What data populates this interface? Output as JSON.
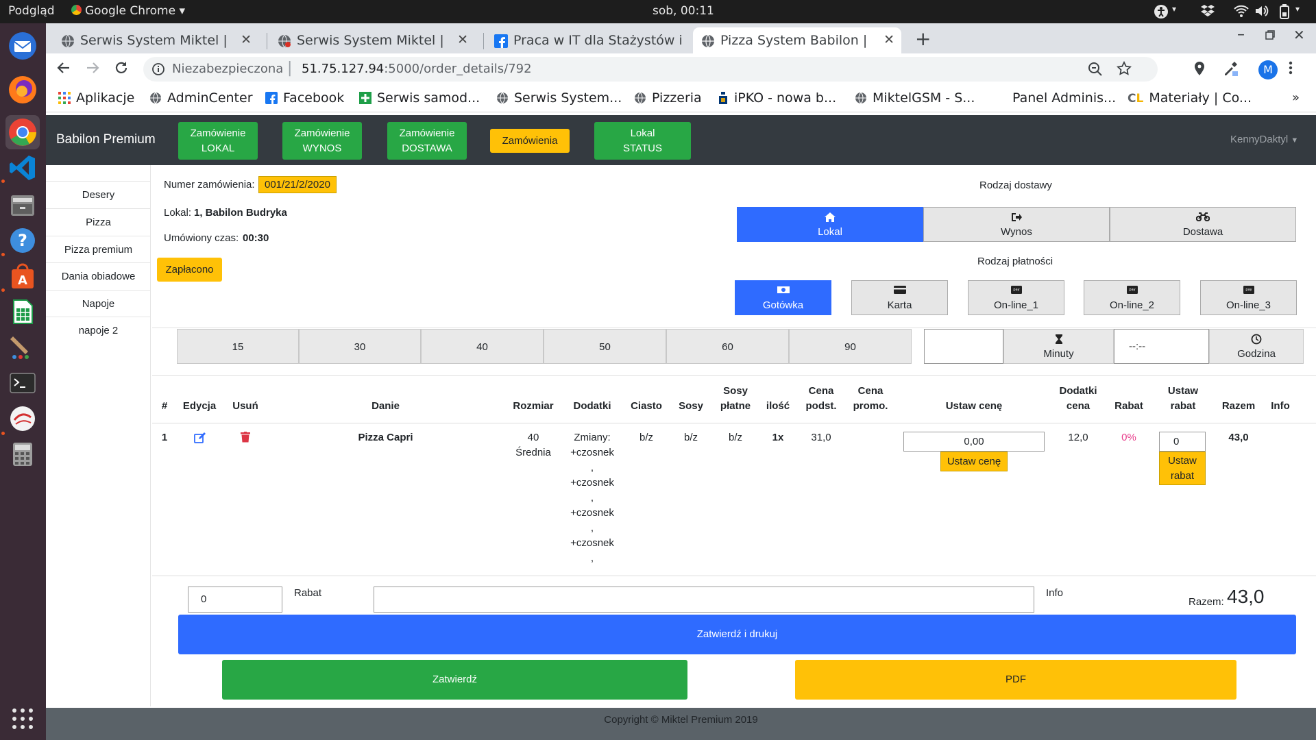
{
  "os": {
    "activities": "Podgląd",
    "app_name": "Google Chrome",
    "clock": "sob, 00:11"
  },
  "browser": {
    "tabs": [
      {
        "title": "Serwis System Miktel |"
      },
      {
        "title": "Serwis System Miktel |"
      },
      {
        "title": "Praca w IT dla Stażystów i"
      },
      {
        "title": "Pizza System Babilon |"
      }
    ],
    "security_label": "Niezabezpieczona",
    "url_host": "51.75.127.94",
    "url_path": ":5000/order_details/792",
    "profile_initial": "M",
    "bookmarks": [
      "Aplikacje",
      "AdminCenter",
      "Facebook",
      "Serwis samod...",
      "Serwis System...",
      "Pizzeria",
      "iPKO - nowa b...",
      "MiktelGSM - S...",
      "Panel Adminis...",
      "Materiały | Co..."
    ],
    "bookmarks_more": "»"
  },
  "navbar": {
    "brand": "Babilon Premium",
    "btn_lokal": [
      "Zamówienie",
      "LOKAL"
    ],
    "btn_wynos": [
      "Zamówienie",
      "WYNOS"
    ],
    "btn_dostawa": [
      "Zamówienie",
      "DOSTAWA"
    ],
    "btn_zamowienia": "Zamówienia",
    "btn_status": [
      "Lokal",
      "STATUS"
    ],
    "user": "KennyDaktyl"
  },
  "sidebar": {
    "items": [
      "Desery",
      "Pizza",
      "Pizza premium",
      "Dania obiadowe",
      "Napoje",
      "napoje 2"
    ]
  },
  "order": {
    "number_label": "Numer zamówienia:",
    "number": "001/21/2/2020",
    "local_label": "Lokal:",
    "local_value": "1, Babilon Budryka",
    "time_label": "Umówiony czas:",
    "time_value": "00:30",
    "paid_label": "Zapłacono"
  },
  "delivery": {
    "title": "Rodzaj dostawy",
    "options": [
      "Lokal",
      "Wynos",
      "Dostawa"
    ],
    "selected": "Lokal"
  },
  "payment": {
    "title": "Rodzaj płatności",
    "options": [
      "Gotówka",
      "Karta",
      "On-line_1",
      "On-line_2",
      "On-line_3"
    ],
    "selected": "Gotówka"
  },
  "time_presets": [
    "15",
    "30",
    "40",
    "50",
    "60",
    "90"
  ],
  "minutes_label": "Minuty",
  "time_placeholder": "--:--",
  "hour_label": "Godzina",
  "table": {
    "headers": {
      "num": "#",
      "edit": "Edycja",
      "delete": "Usuń",
      "dish": "Danie",
      "size": "Rozmiar",
      "addons": "Dodatki",
      "dough": "Ciasto",
      "sauces": "Sosy",
      "paid_sauces": [
        "Sosy",
        "płatne"
      ],
      "qty": "ilość",
      "base_price": [
        "Cena",
        "podst."
      ],
      "promo_price": [
        "Cena",
        "promo."
      ],
      "set_price": "Ustaw cenę",
      "addons_price": [
        "Dodatki",
        "cena"
      ],
      "discount": "Rabat",
      "set_discount": [
        "Ustaw",
        "rabat"
      ],
      "total": "Razem",
      "info": "Info"
    },
    "rows": [
      {
        "num": "1",
        "dish": "Pizza Capri",
        "size": [
          "40",
          "Średnia"
        ],
        "addons": [
          "Zmiany:",
          "+czosnek",
          ",",
          "+czosnek",
          ",",
          "+czosnek",
          ",",
          "+czosnek",
          ","
        ],
        "dough": "b/z",
        "sauces": "b/z",
        "paid_sauces": "b/z",
        "qty": "1x",
        "base_price": "31,0",
        "promo_price": "",
        "set_price_value": "0,00",
        "set_price_button": "Ustaw cenę",
        "addons_price": "12,0",
        "discount": "0%",
        "set_discount_value": "0",
        "set_discount_button": [
          "Ustaw",
          "rabat"
        ],
        "total": "43,0",
        "info": ""
      }
    ]
  },
  "footer_form": {
    "discount_value": "0",
    "discount_label": "Rabat",
    "info_value": "",
    "info_label": "Info",
    "total_label": "Razem:",
    "total_value": "43,0",
    "confirm_print": "Zatwierdź i drukuj",
    "confirm": "Zatwierdź",
    "pdf": "PDF"
  },
  "copyright": "Copyright © Miktel Premium 2019",
  "colors": {
    "green": "#28a745",
    "yellow": "#ffc107",
    "blue": "#2f6bff",
    "navbar": "#343a40",
    "discount_pink": "#e83e8c"
  }
}
